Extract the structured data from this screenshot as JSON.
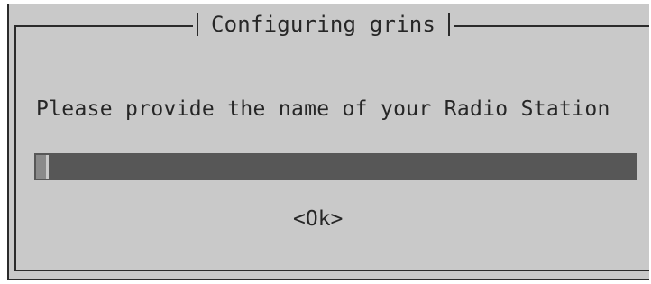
{
  "dialog": {
    "title": "Configuring grins",
    "prompt": "Please provide the name of your Radio Station",
    "input_value": "",
    "ok_label": "<Ok>"
  }
}
